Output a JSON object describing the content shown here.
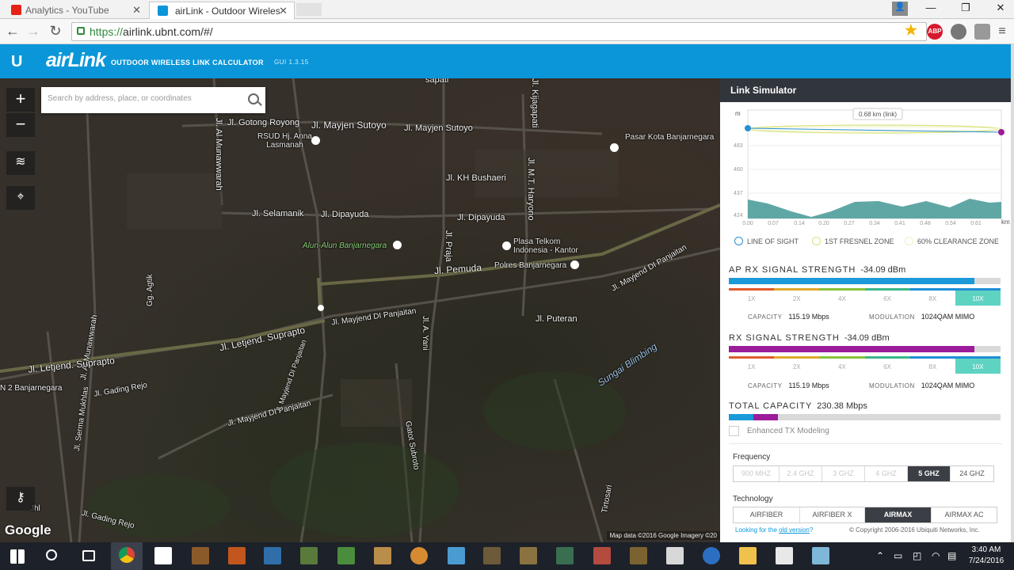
{
  "browser": {
    "tabs": [
      {
        "title": "Analytics - YouTube",
        "active": false
      },
      {
        "title": "airLink - Outdoor Wireles",
        "active": true
      }
    ],
    "url_scheme": "https://",
    "url_rest": "airlink.ubnt.com/#/",
    "extensions": [
      "star-icon",
      "adblock-icon",
      "settings-extension-icon",
      "puzzle-icon"
    ],
    "adblock_label": "ABP"
  },
  "app": {
    "logo": "U",
    "brand": "airLink",
    "subtitle": "OUTDOOR WIRELESS LINK CALCULATOR",
    "version": "GUI 1.3.15"
  },
  "map": {
    "search_placeholder": "Search by address, place, or coordinates",
    "controls": [
      "zoom-in",
      "zoom-out",
      "layers",
      "markers",
      "key"
    ],
    "zoom_in": "+",
    "zoom_out": "−",
    "google": "Google",
    "attribution": "Map data ©2016 Google Imagery ©20",
    "streets": {
      "gotong_royong": "Jl. Gotong Royong",
      "mayjen_sutoyo_1": "Jl. Mayjen Sutoyo",
      "mayjen_sutoyo_2": "Jl. Mayjen Sutoyo",
      "al_munawwarah_1": "Jl. Al Munawwarah",
      "selamanik": "Jl. Selamanik",
      "dipayuda_1": "Jl. Dipayuda",
      "dipayuda_2": "Jl. Dipayuda",
      "kh_bushaeri": "Jl. KH Bushaeri",
      "mt_haryono": "Jl. M.T. Haryono",
      "kijagapati": "Jl. Kijagapati",
      "pemuda": "Jl. Pemuda",
      "praja": "Jl. Praja",
      "mayjend_panjaitan_1": "Jl. Mayjend DI Panjaitan",
      "mayjend_panjaitan_2": "Jl. Mayjend DI Panjaitan",
      "mayjend_panjaitan_3": "Jl. Mayjend DI Panjaitan",
      "mayjend_panjaitan_4": "Jl. Mayjend DI Panjaitan",
      "letjend_suprapto_1": "Jl. Letjend. Suprapto",
      "letjend_suprapto_2": "Jl. Letjend. Suprapto",
      "puteran": "Jl. Puteran",
      "a_yani": "Jl. A. Yani",
      "agtik": "Gg. Agtik",
      "al_munawwarah_2": "Jl. Al Munawwarah",
      "gading_rejo_1": "Jl. Gading Rejo",
      "gading_rejo_2": "Jl. Gading Rejo",
      "serma_mukhlas": "Jl. Serma Mukhlas",
      "gatot_subroto": "Gatot Subroto",
      "tirtosari": "Tirtosari",
      "sungai": "Sungai Blimbing",
      "sapati": "sapati",
      "jhl": "Jhl",
      "banjarnegara_2": "N 2 Banjarnegara"
    },
    "pois": {
      "rsud": "RSUD Hj. Anna\nLasmanah",
      "alun": "Alun-Alun Banjarnegara",
      "plasa": "Plasa Telkom\nIndonesia - Kantor",
      "polres": "Polres Banjarnegara",
      "pasar": "Pasar Kota Banjarnegara"
    }
  },
  "simulator": {
    "title": "Link Simulator",
    "link_distance_label": "0.68 km (link)",
    "y_axis_unit": "m",
    "x_axis_unit": "km",
    "y_ticks": [
      "483",
      "460",
      "437",
      "424"
    ],
    "x_ticks": [
      "0.00",
      "0.07",
      "0.14",
      "0.20",
      "0.27",
      "0.34",
      "0.41",
      "0.48",
      "0.54",
      "0.61"
    ],
    "legend": {
      "los": "LINE OF SIGHT",
      "fresnel": "1ST FRESNEL ZONE",
      "clearance": "60% CLEARANCE ZONE"
    },
    "ap": {
      "label": "AP RX SIGNAL STRENGTH",
      "value": "-34.09 dBm",
      "fill_fraction": 0.905,
      "color": "#1a9ad9",
      "capacity_label": "CAPACITY",
      "capacity": "115.19 Mbps",
      "modulation_label": "MODULATION",
      "modulation": "1024QAM MIMO"
    },
    "rx": {
      "label": "RX SIGNAL STRENGTH",
      "value": "-34.09 dBm",
      "fill_fraction": 0.905,
      "color": "#9c1c9a",
      "capacity_label": "CAPACITY",
      "capacity": "115.19 Mbps",
      "modulation_label": "MODULATION",
      "modulation": "1024QAM MIMO"
    },
    "scale_marks": [
      "1X",
      "2X",
      "4X",
      "6X",
      "8X",
      "10X"
    ],
    "scale_active": "10X",
    "scale_colors": [
      "#e05a2b",
      "#e0a92b",
      "#88c33a",
      "#39b889",
      "#1f8fd6",
      "#1f8fd6"
    ],
    "total": {
      "label": "TOTAL CAPACITY",
      "value": "230.38 Mbps",
      "ap_fraction": 0.09,
      "rx_fraction": 0.09
    },
    "enhanced_tx": "Enhanced TX Modeling",
    "frequency": {
      "label": "Frequency",
      "options": [
        "900 MHZ",
        "2.4 GHZ",
        "3 GHZ",
        "4 GHZ",
        "5 GHZ",
        "24 GHZ"
      ],
      "selected": "5 GHZ"
    },
    "technology": {
      "label": "Technology",
      "options": [
        "AIRFIBER",
        "AIRFIBER X",
        "AIRMAX",
        "AIRMAX AC"
      ],
      "selected": "AIRMAX"
    },
    "footer_prefix": "Looking for the ",
    "footer_link": "old version",
    "footer_suffix": "?",
    "copyright": "© Copyright 2006-2016 Ubiquiti Networks, Inc."
  },
  "taskbar": {
    "time": "3:40 AM",
    "date": "7/24/2016"
  }
}
